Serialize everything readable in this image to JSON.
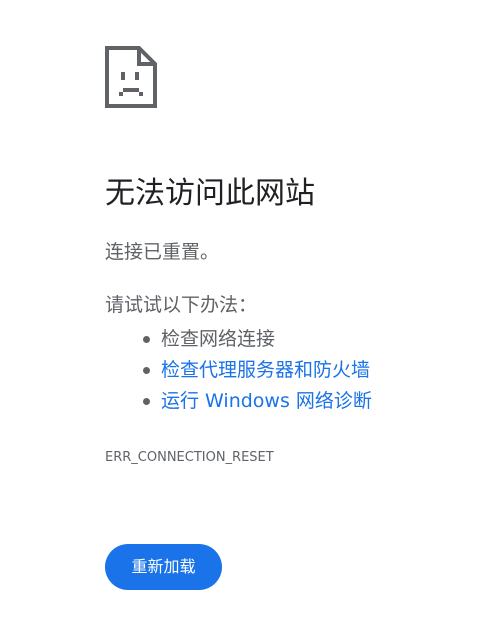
{
  "error_page": {
    "icon": "sad-document-icon",
    "title": "无法访问此网站",
    "subtitle": "连接已重置。",
    "suggestions_heading": "请试试以下办法：",
    "suggestions": [
      {
        "label": "检查网络连接",
        "link": false
      },
      {
        "label": "检查代理服务器和防火墙",
        "link": true
      },
      {
        "label": "运行 Windows 网络诊断",
        "link": true
      }
    ],
    "error_code": "ERR_CONNECTION_RESET",
    "reload_button_label": "重新加载"
  },
  "colors": {
    "accent": "#1a73e8",
    "text_primary": "#202124",
    "text_secondary": "#5f6368",
    "background": "#ffffff"
  }
}
